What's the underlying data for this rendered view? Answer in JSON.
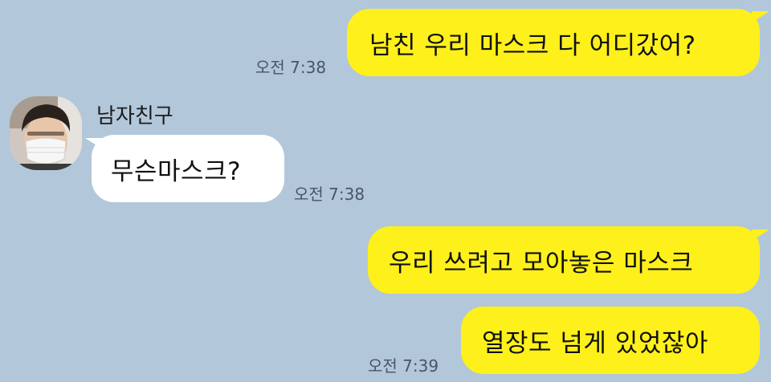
{
  "chat": {
    "contact": {
      "name": "남자친구",
      "avatar_icon": "boyfriend-avatar-masked"
    },
    "messages": [
      {
        "side": "out",
        "text": "남친 우리 마스크 다 어디갔어?",
        "time": "오전 7:38"
      },
      {
        "side": "in",
        "text": "무슨마스크?",
        "time": "오전 7:38"
      },
      {
        "side": "out",
        "text": "우리 쓰려고 모아놓은 마스크",
        "time": ""
      },
      {
        "side": "out",
        "text": "열장도 넘게 있었잖아",
        "time": "오전 7:39"
      }
    ]
  },
  "colors": {
    "background": "#b2c7da",
    "outgoing_bubble": "#fef01b",
    "incoming_bubble": "#ffffff",
    "timestamp_text": "#4a5563"
  }
}
